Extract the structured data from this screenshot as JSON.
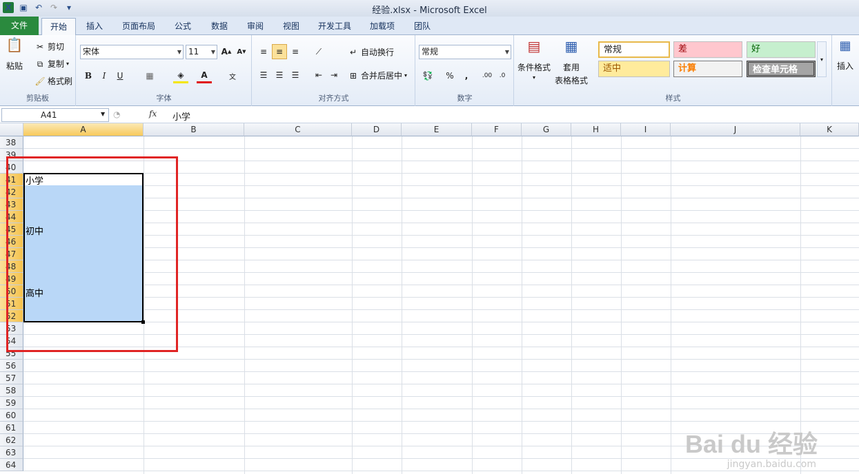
{
  "window": {
    "title": "经验.xlsx - Microsoft Excel"
  },
  "tabs": [
    "文件",
    "开始",
    "插入",
    "页面布局",
    "公式",
    "数据",
    "审阅",
    "视图",
    "开发工具",
    "加载项",
    "团队"
  ],
  "clipboard": {
    "paste": "粘贴",
    "cut": "剪切",
    "copy": "复制",
    "format_painter": "格式刷",
    "group": "剪贴板"
  },
  "font": {
    "name": "宋体",
    "size": "11",
    "group": "字体"
  },
  "alignment": {
    "wrap": "自动换行",
    "merge": "合并后居中",
    "group": "对齐方式"
  },
  "number": {
    "format": "常规",
    "group": "数字"
  },
  "styles": {
    "cond": "条件格式",
    "table1": "套用",
    "table2": "表格格式",
    "normal": "常规",
    "bad": "差",
    "good": "好",
    "neutral": "适中",
    "calc": "计算",
    "check": "检查单元格",
    "group": "样式"
  },
  "cells": {
    "insert": "插入"
  },
  "formula_bar": {
    "name_box": "A41",
    "fx": "fx",
    "value": "小学"
  },
  "columns": [
    "A",
    "B",
    "C",
    "D",
    "E",
    "F",
    "G",
    "H",
    "I",
    "J",
    "K"
  ],
  "rows": [
    "38",
    "39",
    "40",
    "41",
    "42",
    "43",
    "44",
    "45",
    "46",
    "47",
    "48",
    "49",
    "50",
    "51",
    "52",
    "53",
    "54",
    "55",
    "56",
    "57",
    "58",
    "59",
    "60",
    "61",
    "62",
    "63",
    "64"
  ],
  "cells_data": {
    "a41": "小学",
    "a45": "初中",
    "a50": "高中"
  },
  "watermark": {
    "logo": "Bai du 经验",
    "url": "jingyan.baidu.com"
  }
}
